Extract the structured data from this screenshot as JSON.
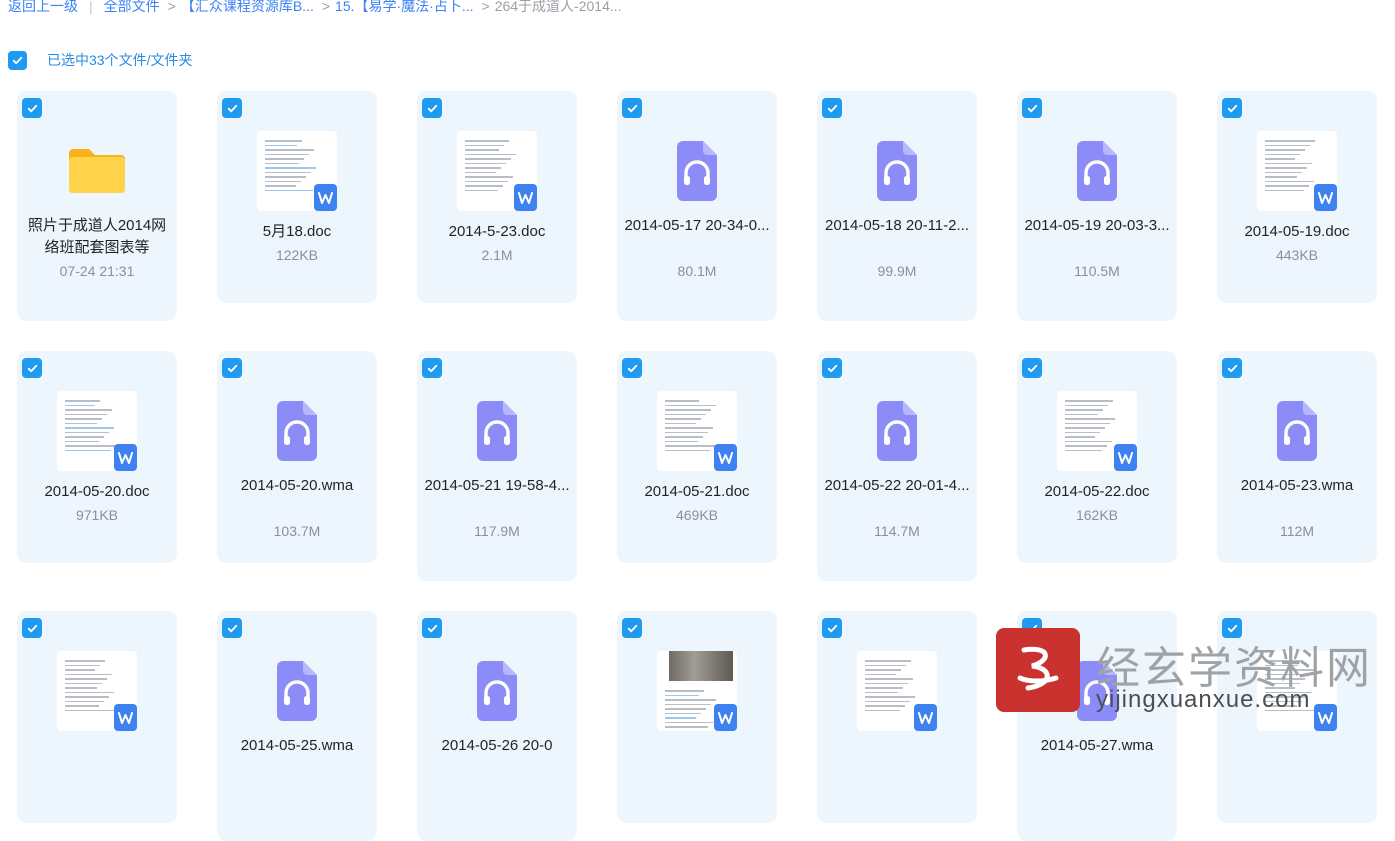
{
  "breadcrumb": {
    "back": "返回上一级",
    "items": [
      "全部文件",
      "【汇众课程资源库B...",
      "15.【易学·魔法·占卜...",
      "264于成道人-2014..."
    ]
  },
  "selection": {
    "text": "已选中33个文件/文件夹"
  },
  "colors": {
    "accent": "#1e9bf0",
    "card_bg": "#eef6fd",
    "audio": "#8b8cf7",
    "word": "#3d82f0",
    "folder": "#ffc234"
  },
  "files": [
    {
      "type": "folder",
      "icon": "folder-icon",
      "name": "照片于成道人2014网络班配套图表等",
      "meta": "07-24 21:31"
    },
    {
      "type": "doc",
      "icon": "word-doc-icon",
      "name": "5月18.doc",
      "meta": "122KB"
    },
    {
      "type": "doc",
      "icon": "word-doc-icon",
      "name": "2014-5-23.doc",
      "meta": "2.1M"
    },
    {
      "type": "audio",
      "icon": "audio-file-icon",
      "name": "2014-05-17 20-34-0...",
      "meta": "80.1M"
    },
    {
      "type": "audio",
      "icon": "audio-file-icon",
      "name": "2014-05-18 20-11-2...",
      "meta": "99.9M"
    },
    {
      "type": "audio",
      "icon": "audio-file-icon",
      "name": "2014-05-19 20-03-3...",
      "meta": "110.5M"
    },
    {
      "type": "doc",
      "icon": "word-doc-icon",
      "name": "2014-05-19.doc",
      "meta": "443KB"
    },
    {
      "type": "doc",
      "icon": "word-doc-icon",
      "name": "2014-05-20.doc",
      "meta": "971KB"
    },
    {
      "type": "audio",
      "icon": "audio-file-icon",
      "name": "2014-05-20.wma",
      "meta": "103.7M"
    },
    {
      "type": "audio",
      "icon": "audio-file-icon",
      "name": "2014-05-21 19-58-4...",
      "meta": "117.9M"
    },
    {
      "type": "doc",
      "icon": "word-doc-icon",
      "name": "2014-05-21.doc",
      "meta": "469KB"
    },
    {
      "type": "audio",
      "icon": "audio-file-icon",
      "name": "2014-05-22 20-01-4...",
      "meta": "114.7M"
    },
    {
      "type": "doc",
      "icon": "word-doc-icon",
      "name": "2014-05-22.doc",
      "meta": "162KB"
    },
    {
      "type": "audio",
      "icon": "audio-file-icon",
      "name": "2014-05-23.wma",
      "meta": "112M"
    },
    {
      "type": "doc",
      "icon": "word-doc-icon",
      "name": "",
      "meta": ""
    },
    {
      "type": "audio",
      "icon": "audio-file-icon",
      "name": "2014-05-25.wma",
      "meta": ""
    },
    {
      "type": "audio",
      "icon": "audio-file-icon",
      "name": "2014-05-26 20-0",
      "meta": ""
    },
    {
      "type": "doc",
      "icon": "word-doc-icon",
      "name": "",
      "meta": ""
    },
    {
      "type": "doc",
      "icon": "word-doc-icon",
      "name": "",
      "meta": ""
    },
    {
      "type": "audio",
      "icon": "audio-file-icon",
      "name": "2014-05-27.wma",
      "meta": ""
    },
    {
      "type": "doc",
      "icon": "word-doc-icon",
      "name": "",
      "meta": ""
    }
  ],
  "watermark": {
    "title": "经玄学资料网",
    "url": "yijingxuanxue.com"
  }
}
